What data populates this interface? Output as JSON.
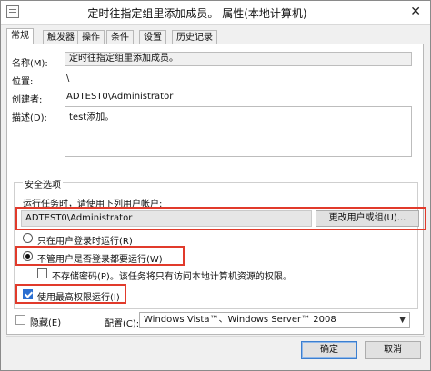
{
  "window": {
    "title": "定时往指定组里添加成员。 属性(本地计算机)",
    "close_glyph": "✕"
  },
  "tabs": [
    {
      "label": "常规",
      "active": true
    },
    {
      "label": "触发器"
    },
    {
      "label": "操作"
    },
    {
      "label": "条件"
    },
    {
      "label": "设置"
    },
    {
      "label": "历史记录"
    }
  ],
  "general": {
    "name_label": "名称(M):",
    "name_value": "定时往指定组里添加成员。",
    "location_label": "位置:",
    "location_value": "\\",
    "author_label": "创建者:",
    "author_value": "ADTEST0\\Administrator",
    "description_label": "描述(D):",
    "description_value": "test添加。"
  },
  "security": {
    "group_title": "安全选项",
    "runas_prompt": "运行任务时，请使用下列用户帐户:",
    "runas_user": "ADTEST0\\Administrator",
    "change_user_button": "更改用户或组(U)...",
    "radio_logged_on": "只在用户登录时运行(R)",
    "radio_always": "不管用户是否登录都要运行(W)",
    "no_store_password": "不存储密码(P)。该任务将只有访问本地计算机资源的权限。",
    "highest_privileges": "使用最高权限运行(I)"
  },
  "bottom": {
    "hidden_label": "隐藏(E)",
    "configure_label": "配置(C):",
    "configure_value": "Windows Vista™、Windows Server™ 2008",
    "ok_button": "确定",
    "cancel_button": "取消"
  },
  "state": {
    "radio_always_selected": true,
    "highest_privileges_checked": true,
    "hidden_checked": false,
    "no_store_password_checked": false
  },
  "colors": {
    "highlight": "#e13a2b",
    "checkbox_accent": "#2b6fd1"
  },
  "icons": [
    "task-properties-icon",
    "close-icon",
    "dropdown-chevron-icon"
  ]
}
